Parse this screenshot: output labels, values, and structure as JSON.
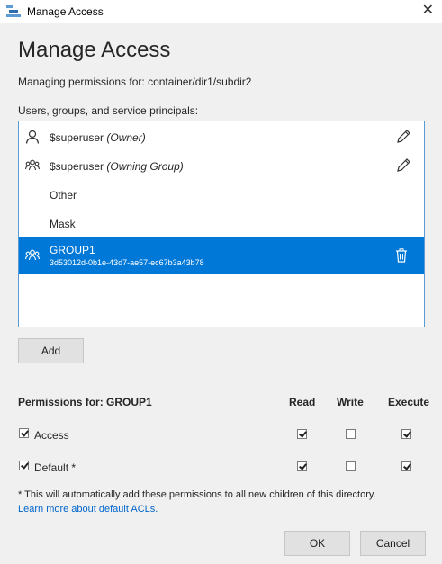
{
  "window": {
    "title": "Manage Access",
    "close_glyph": "✕"
  },
  "heading": "Manage Access",
  "managing_text": "Managing permissions for: container/dir1/subdir2",
  "users_label": "Users, groups, and service principals:",
  "principals": [
    {
      "name": "$superuser",
      "role": "(Owner)",
      "icon": "user-icon",
      "editable": true
    },
    {
      "name": "$superuser",
      "role": "(Owning Group)",
      "icon": "group-icon",
      "editable": true
    },
    {
      "name": "Other",
      "role": "",
      "icon": "",
      "editable": false
    },
    {
      "name": "Mask",
      "role": "",
      "icon": "",
      "editable": false
    },
    {
      "name": "GROUP1",
      "id": "3d53012d-0b1e-43d7-ae57-ec67b3a43b78",
      "icon": "group-icon",
      "selected": true
    }
  ],
  "add_button": "Add",
  "permissions": {
    "header": "Permissions for: GROUP1",
    "columns": [
      "Read",
      "Write",
      "Execute"
    ],
    "rows": [
      {
        "label": "Access",
        "enabled": true,
        "read": true,
        "write": false,
        "execute": true
      },
      {
        "label": "Default *",
        "enabled": true,
        "read": true,
        "write": false,
        "execute": true
      }
    ]
  },
  "note": "* This will automatically add these permissions to all new children of this directory.",
  "learn_more": "Learn more about default ACLs.",
  "ok_button": "OK",
  "cancel_button": "Cancel",
  "colors": {
    "selection": "#0078d7",
    "link": "#0066cc",
    "list_border": "#5b9bd5"
  }
}
